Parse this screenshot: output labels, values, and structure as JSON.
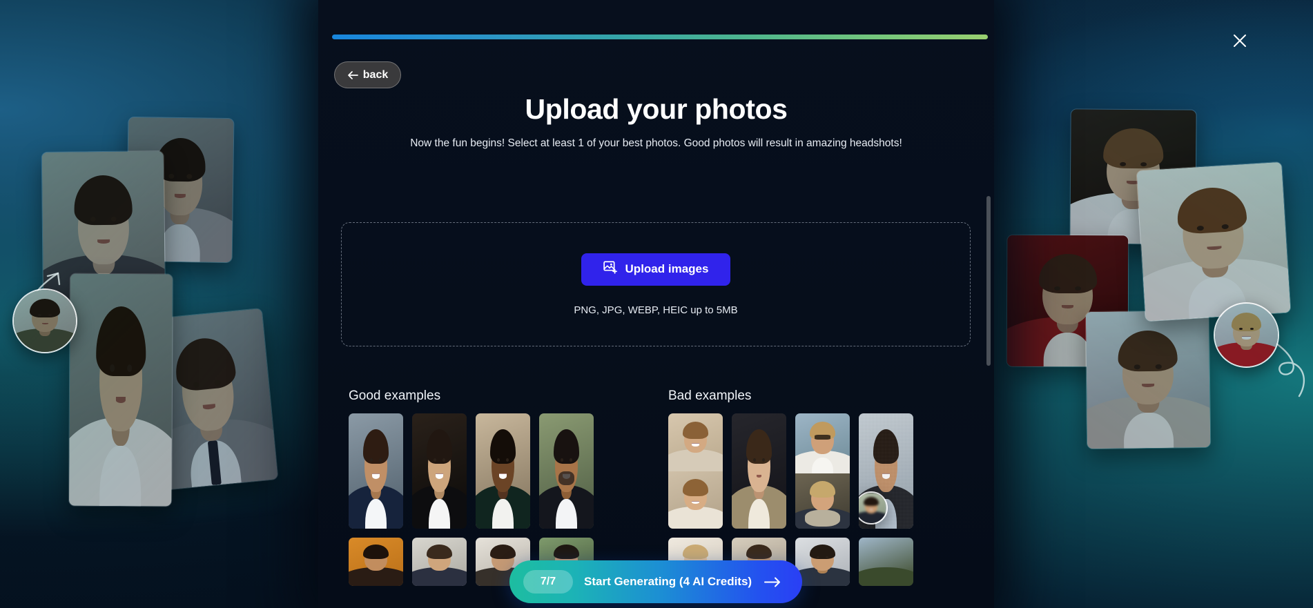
{
  "window": {
    "background_accent_left": "#147279",
    "background_accent_right": "#14777c",
    "panel_background": "#070f1d"
  },
  "header": {
    "close_icon": "close-icon",
    "back_label": "back",
    "back_icon": "arrow-left-icon",
    "progress": {
      "value_percent": 100,
      "gradient_start": "#1886dd",
      "gradient_mid": "#35a5a8",
      "gradient_end": "#99cf70"
    }
  },
  "main": {
    "title": "Upload your photos",
    "subtitle": "Now the fun begins! Select at least 1 of your best photos. Good photos will result in amazing headshots!",
    "dropzone": {
      "upload_button_label": "Upload images",
      "upload_button_icon": "image-add-icon",
      "upload_button_color": "#3023eb",
      "hint": "PNG, JPG, WEBP, HEIC up to 5MB"
    },
    "examples": {
      "good": {
        "heading": "Good examples",
        "row1": [
          "smiling-woman-navy-blazer",
          "man-black-suit-white-shirt",
          "smiling-woman-dark-blazer",
          "bearded-man-navy-suit"
        ],
        "row2": [
          "woman-orange-background",
          "man-light-background",
          "woman-neutral-background",
          "man-green-background"
        ]
      },
      "bad": {
        "heading": "Bad examples",
        "row1": [
          "two-stacked-casual-photos",
          "woman-checked-blazer-dark-bg",
          "man-sunglasses-and-scarf-woman",
          "noisy-photo-with-circle-crop"
        ],
        "row2": [
          "blonde-hair-closeup",
          "backlit-portrait",
          "man-beach-selfie",
          "outdoor-tree-photo"
        ]
      }
    }
  },
  "footer": {
    "cta": {
      "count_badge": "7/7",
      "label": "Start Generating (4 AI Credits)",
      "arrow_icon": "arrow-right-icon",
      "gradient_start": "#1dbda0",
      "gradient_end": "#2a3ff5"
    }
  },
  "scrollbar": {
    "name": "vertical-scrollbar"
  },
  "decor": {
    "left_collage": {
      "cards": [
        "young-man-dark-suit-grey-bg",
        "young-man-suit-light-grey-bg",
        "young-man-grey-suit-navy-tie",
        "young-man-white-shirt"
      ],
      "avatar": "selfie-man-green-shirt",
      "arrow": "curved-arrow-up-right"
    },
    "right_collage": {
      "cards": [
        "woman-white-shirt-dark-bg",
        "woman-long-hair-white-blazer",
        "woman-red-blazer-red-bg",
        "woman-grey-blazer-window-bg"
      ],
      "avatar": "selfie-woman-red-top",
      "arrow": "curved-arrow-up-left"
    }
  }
}
